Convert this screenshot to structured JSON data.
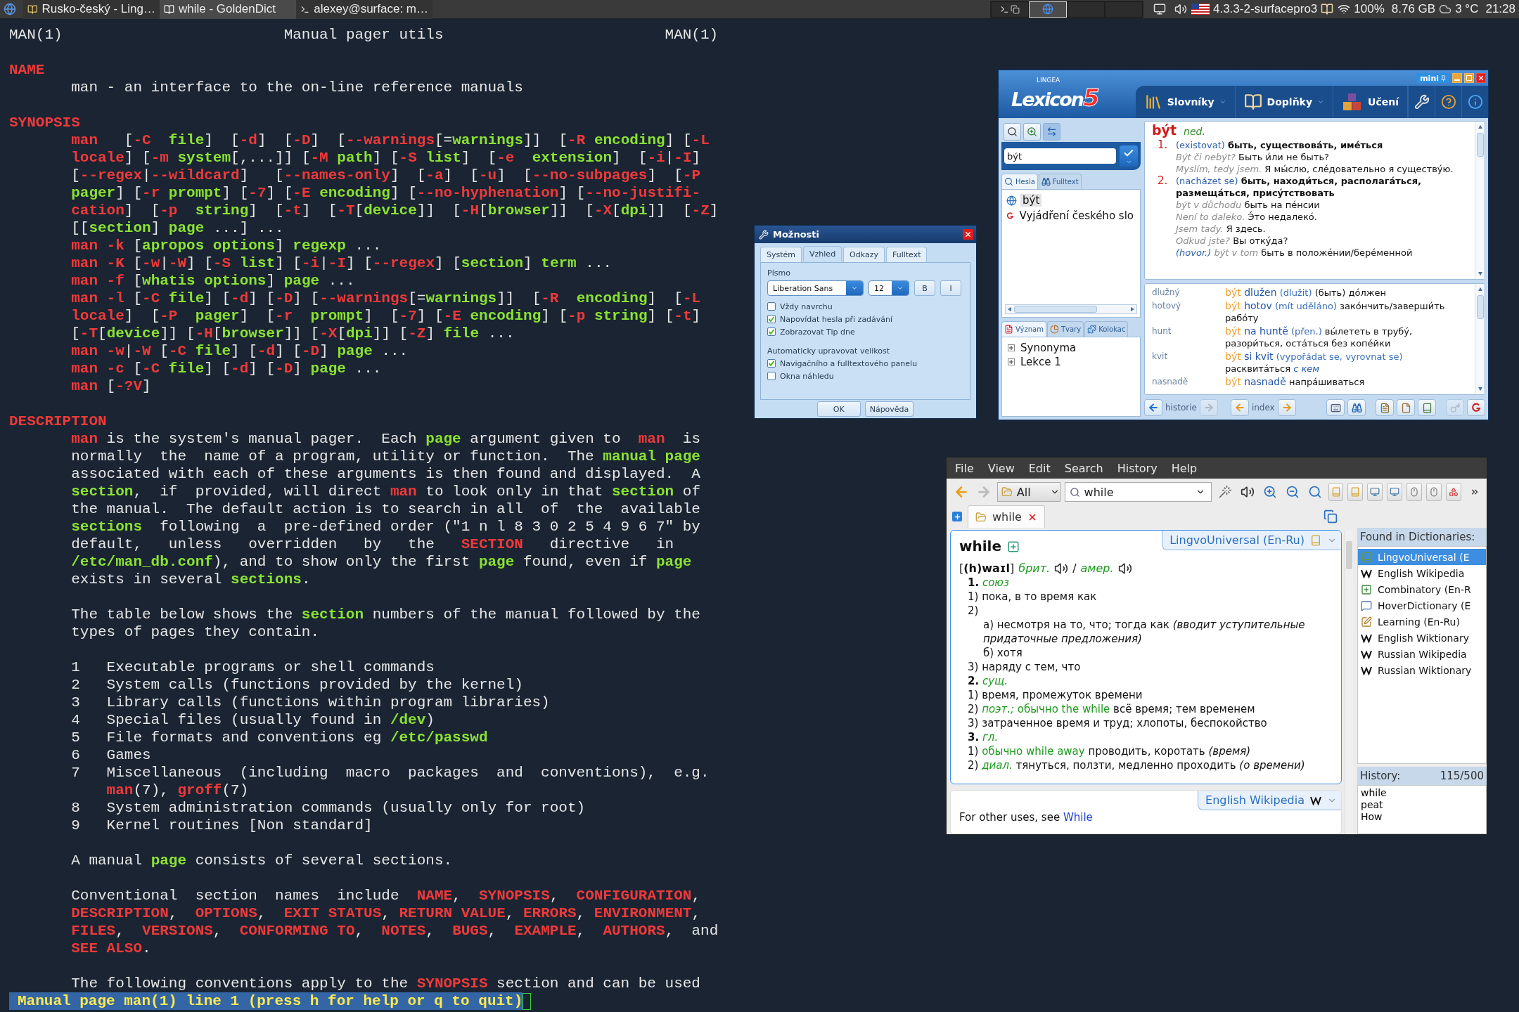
{
  "taskbar": {
    "tasks": [
      {
        "label": "Rusko-český - Ling…",
        "selected": false
      },
      {
        "label": "while - GoldenDict",
        "selected": true
      },
      {
        "label": "alexey@surface: m…",
        "selected": false
      }
    ],
    "kernel": "4.3.3-2-surfacepro3",
    "battery": "100%",
    "memory": "8.76 GB",
    "temperature": "3 °C",
    "clock": "21:28"
  },
  "terminal": {
    "blocks": [
      [
        {
          "kind": "heading",
          "text": [
            "MAN(1)                         Manual pager utils                         MAN(1)"
          ]
        }
      ],
      [
        {
          "kind": "heading",
          "text": [
            {
              "keyword": "NAME"
            }
          ]
        },
        {
          "kind": "body",
          "text": [
            "man - an interface to the on-line reference manuals"
          ]
        }
      ],
      [
        {
          "kind": "heading",
          "text": [
            {
              "keyword": "SYNOPSIS"
            }
          ]
        },
        {
          "kind": "body",
          "text": [
            {
              "keyword": "man"
            },
            "   [",
            {
              "keyword": "-C  "
            },
            {
              "argument": "file"
            },
            "]  [",
            {
              "keyword": "-d"
            },
            "]  [",
            {
              "keyword": "-D"
            },
            "]  [",
            {
              "keyword": "--warnings"
            },
            "[=",
            {
              "argument": "warnings"
            },
            "]]  [",
            {
              "keyword": "-R "
            },
            {
              "argument": "encoding"
            },
            "] [",
            {
              "keyword": "-L"
            }
          ]
        },
        {
          "kind": "body",
          "text": [
            {
              "keyword": "locale"
            },
            "] [",
            {
              "keyword": "-m "
            },
            {
              "argument": "system"
            },
            "[,...]] [",
            {
              "keyword": "-M "
            },
            {
              "argument": "path"
            },
            "] [",
            {
              "keyword": "-S "
            },
            {
              "argument": "list"
            },
            "]  [",
            {
              "keyword": "-e  "
            },
            {
              "argument": "extension"
            },
            "]  [",
            {
              "keyword": "-i"
            },
            "|",
            {
              "keyword": "-I"
            },
            "]"
          ]
        },
        {
          "kind": "body",
          "text": [
            "[",
            {
              "keyword": "--regex"
            },
            "|",
            {
              "keyword": "--wildcard"
            },
            "]   [",
            {
              "keyword": "--names-only"
            },
            "]  [",
            {
              "keyword": "-a"
            },
            "]  [",
            {
              "keyword": "-u"
            },
            "]  [",
            {
              "keyword": "--no-subpages"
            },
            "]  [",
            {
              "keyword": "-P"
            }
          ]
        },
        {
          "kind": "body",
          "text": [
            {
              "argument": "pager"
            },
            "] [",
            {
              "keyword": "-r "
            },
            {
              "argument": "prompt"
            },
            "] [",
            {
              "keyword": "-7"
            },
            "] [",
            {
              "keyword": "-E "
            },
            {
              "argument": "encoding"
            },
            "] [",
            {
              "keyword": "--no-hyphenation"
            },
            "] [",
            {
              "keyword": "--no-justifi-"
            }
          ]
        },
        {
          "kind": "body",
          "text": [
            {
              "keyword": "cation"
            },
            "]  [",
            {
              "keyword": "-p  "
            },
            {
              "argument": "string"
            },
            "]  [",
            {
              "keyword": "-t"
            },
            "]  [",
            {
              "keyword": "-T"
            },
            "[",
            {
              "argument": "device"
            },
            "]]  [",
            {
              "keyword": "-H"
            },
            "[",
            {
              "argument": "browser"
            },
            "]]  [",
            {
              "keyword": "-X"
            },
            "[",
            {
              "argument": "dpi"
            },
            "]]  [",
            {
              "keyword": "-Z"
            },
            "]"
          ]
        },
        {
          "kind": "body",
          "text": [
            "[[",
            {
              "argument": "section"
            },
            "] ",
            {
              "argument": "page"
            },
            " ...] ..."
          ]
        },
        {
          "kind": "body",
          "text": [
            {
              "keyword": "man -k"
            },
            " [",
            {
              "argument": "apropos options"
            },
            "] ",
            {
              "argument": "regexp"
            },
            " ..."
          ]
        },
        {
          "kind": "body",
          "text": [
            {
              "keyword": "man -K"
            },
            " [",
            {
              "keyword": "-w"
            },
            "|",
            {
              "keyword": "-W"
            },
            "] [",
            {
              "keyword": "-S "
            },
            {
              "argument": "list"
            },
            "] [",
            {
              "keyword": "-i"
            },
            "|",
            {
              "keyword": "-I"
            },
            "] [",
            {
              "keyword": "--regex"
            },
            "] [",
            {
              "argument": "section"
            },
            "] ",
            {
              "argument": "term"
            },
            " ..."
          ]
        },
        {
          "kind": "body",
          "text": [
            {
              "keyword": "man -f"
            },
            " [",
            {
              "argument": "whatis options"
            },
            "] ",
            {
              "argument": "page"
            },
            " ..."
          ]
        },
        {
          "kind": "body",
          "text": [
            {
              "keyword": "man -l"
            },
            " [",
            {
              "keyword": "-C "
            },
            {
              "argument": "file"
            },
            "] [",
            {
              "keyword": "-d"
            },
            "] [",
            {
              "keyword": "-D"
            },
            "] [",
            {
              "keyword": "--warnings"
            },
            "[=",
            {
              "argument": "warnings"
            },
            "]]  [",
            {
              "keyword": "-R  "
            },
            {
              "argument": "encoding"
            },
            "]  [",
            {
              "keyword": "-L"
            }
          ]
        },
        {
          "kind": "body",
          "text": [
            {
              "keyword": "locale"
            },
            "]  [",
            {
              "keyword": "-P  "
            },
            {
              "argument": "pager"
            },
            "]  [",
            {
              "keyword": "-r  "
            },
            {
              "argument": "prompt"
            },
            "]  [",
            {
              "keyword": "-7"
            },
            "] [",
            {
              "keyword": "-E "
            },
            {
              "argument": "encoding"
            },
            "] [",
            {
              "keyword": "-p "
            },
            {
              "argument": "string"
            },
            "] [",
            {
              "keyword": "-t"
            },
            "]"
          ]
        },
        {
          "kind": "body",
          "text": [
            "[",
            {
              "keyword": "-T"
            },
            "[",
            {
              "argument": "device"
            },
            "]] [",
            {
              "keyword": "-H"
            },
            "[",
            {
              "argument": "browser"
            },
            "]] [",
            {
              "keyword": "-X"
            },
            "[",
            {
              "argument": "dpi"
            },
            "]] [",
            {
              "keyword": "-Z"
            },
            "] ",
            {
              "argument": "file"
            },
            " ..."
          ]
        },
        {
          "kind": "body",
          "text": [
            {
              "keyword": "man -w"
            },
            "|",
            {
              "keyword": "-W"
            },
            " [",
            {
              "keyword": "-C "
            },
            {
              "argument": "file"
            },
            "] [",
            {
              "keyword": "-d"
            },
            "] [",
            {
              "keyword": "-D"
            },
            "] ",
            {
              "argument": "page"
            },
            " ..."
          ]
        },
        {
          "kind": "body",
          "text": [
            {
              "keyword": "man -c"
            },
            " [",
            {
              "keyword": "-C "
            },
            {
              "argument": "file"
            },
            "] [",
            {
              "keyword": "-d"
            },
            "] [",
            {
              "keyword": "-D"
            },
            "] ",
            {
              "argument": "page"
            },
            " ..."
          ]
        },
        {
          "kind": "body",
          "text": [
            {
              "keyword": "man"
            },
            " [",
            {
              "keyword": "-?V"
            },
            "]"
          ]
        }
      ],
      [
        {
          "kind": "heading",
          "text": [
            {
              "keyword": "DESCRIPTION"
            }
          ]
        },
        {
          "kind": "body",
          "text": [
            {
              "keyword": "man"
            },
            " is the system's manual pager.  Each ",
            {
              "argument": "page"
            },
            " argument given to  ",
            {
              "keyword": "man"
            },
            "  is"
          ]
        },
        {
          "kind": "body",
          "text": [
            "normally  the  name of a program, utility or function.  The ",
            {
              "argument": "manual page"
            }
          ]
        },
        {
          "kind": "body",
          "text": [
            "associated with each of these arguments is then found and displayed.  A"
          ]
        },
        {
          "kind": "body",
          "text": [
            {
              "argument": "section"
            },
            ",  if  provided, will direct ",
            {
              "keyword": "man"
            },
            " to look only in that ",
            {
              "argument": "section"
            },
            " of"
          ]
        },
        {
          "kind": "body",
          "text": [
            "the manual.  The default action is to search in all  of  the  available"
          ]
        },
        {
          "kind": "body",
          "text": [
            {
              "argument": "sections"
            },
            "  following  a  pre-defined order (\"1 n l 8 3 0 2 5 4 9 6 7\" by"
          ]
        },
        {
          "kind": "body",
          "text": [
            "default,   unless   overridden   by   the   ",
            {
              "keyword": "SECTION"
            },
            "   directive   in"
          ]
        },
        {
          "kind": "body",
          "text": [
            {
              "argument": "/etc/man_db.conf"
            },
            "), and to show only the first ",
            {
              "argument": "page"
            },
            " found, even if ",
            {
              "argument": "page"
            }
          ]
        },
        {
          "kind": "body",
          "text": [
            "exists in several ",
            {
              "argument": "sections"
            },
            "."
          ]
        }
      ],
      [
        {
          "kind": "body",
          "text": [
            "The table below shows the ",
            {
              "argument": "section"
            },
            " numbers of the manual followed by the"
          ]
        },
        {
          "kind": "body",
          "text": [
            "types of pages they contain."
          ]
        }
      ],
      [
        {
          "kind": "body",
          "text": [
            "1   Executable programs or shell commands"
          ]
        },
        {
          "kind": "body",
          "text": [
            "2   System calls (functions provided by the kernel)"
          ]
        },
        {
          "kind": "body",
          "text": [
            "3   Library calls (functions within program libraries)"
          ]
        },
        {
          "kind": "body",
          "text": [
            "4   Special files (usually found in ",
            {
              "argument": "/dev"
            },
            ")"
          ]
        },
        {
          "kind": "body",
          "text": [
            "5   File formats and conventions eg ",
            {
              "argument": "/etc/passwd"
            }
          ]
        },
        {
          "kind": "body",
          "text": [
            "6   Games"
          ]
        },
        {
          "kind": "body",
          "text": [
            "7   Miscellaneous  (including  macro  packages  and  conventions),  e.g."
          ]
        },
        {
          "kind": "continuation",
          "text": [
            {
              "keyword": "man"
            },
            "(7), ",
            {
              "keyword": "groff"
            },
            "(7)"
          ]
        },
        {
          "kind": "body",
          "text": [
            "8   System administration commands (usually only for root)"
          ]
        },
        {
          "kind": "body",
          "text": [
            "9   Kernel routines [Non standard]"
          ]
        }
      ],
      [
        {
          "kind": "body",
          "text": [
            "A manual ",
            {
              "argument": "page"
            },
            " consists of several sections."
          ]
        }
      ],
      [
        {
          "kind": "body",
          "text": [
            "Conventional  section  names  include  ",
            {
              "keyword": "NAME"
            },
            ",  ",
            {
              "keyword": "SYNOPSIS"
            },
            ",  ",
            {
              "keyword": "CONFIGURATION"
            },
            ","
          ]
        },
        {
          "kind": "body",
          "text": [
            {
              "keyword": "DESCRIPTION"
            },
            ",  ",
            {
              "keyword": "OPTIONS"
            },
            ",  ",
            {
              "keyword": "EXIT STATUS"
            },
            ", ",
            {
              "keyword": "RETURN VALUE"
            },
            ", ",
            {
              "keyword": "ERRORS"
            },
            ", ",
            {
              "keyword": "ENVIRONMENT"
            },
            ","
          ]
        },
        {
          "kind": "body",
          "text": [
            {
              "keyword": "FILES"
            },
            ",  ",
            {
              "keyword": "VERSIONS"
            },
            ",  ",
            {
              "keyword": "CONFORMING TO"
            },
            ",  ",
            {
              "keyword": "NOTES"
            },
            ",  ",
            {
              "keyword": "BUGS"
            },
            ",  ",
            {
              "keyword": "EXAMPLE"
            },
            ",  ",
            {
              "keyword": "AUTHORS"
            },
            ",  and"
          ]
        },
        {
          "kind": "body",
          "text": [
            {
              "keyword": "SEE ALSO"
            },
            "."
          ]
        }
      ],
      [
        {
          "kind": "body",
          "text": [
            "The following conventions apply to the ",
            {
              "keyword": "SYNOPSIS"
            },
            " section and can be used"
          ]
        }
      ]
    ],
    "status_line": "Manual page man(1) line 1 (press h for help or q to quit)"
  },
  "lexicon": {
    "logo_brand": "LINGEA",
    "logo_name": "Lexicon",
    "logo_version": "5",
    "mini_button": "mini",
    "menu": [
      {
        "label": "Slovníky",
        "dropdown": true
      },
      {
        "label": "Doplňky",
        "dropdown": true
      },
      {
        "label": "Učení",
        "dropdown": false
      }
    ],
    "search_value": "být",
    "list_tabs": [
      {
        "label": "Hesla",
        "selected": true
      },
      {
        "label": "Fulltext",
        "selected": false
      }
    ],
    "results": [
      {
        "label": "být",
        "selected": true
      },
      {
        "label": "Vyjádření českého slo",
        "selected": false
      }
    ],
    "panel_tabs": [
      {
        "label": "Význam",
        "selected": true
      },
      {
        "label": "Tvary",
        "selected": false
      },
      {
        "label": "Kolokac",
        "selected": false
      }
    ],
    "tree": [
      {
        "label": "Synonyma",
        "expanded": false
      },
      {
        "label": "Lekce 1",
        "expanded": false
      }
    ],
    "entry": {
      "headword": "být",
      "pos": "ned.",
      "senses": [
        {
          "number": "1.",
          "domain": "(existovat)",
          "meaning": "быть, существова́ть, име́ться",
          "examples": [
            {
              "cz": "Být či nebýt?",
              "ru": "Быть и́ли не быть?"
            },
            {
              "cz": "Myslím, tedy jsem.",
              "ru": "Я мы́слю, сле́довательно я существу́ю."
            }
          ]
        },
        {
          "number": "2.",
          "domain": "(nacházet se)",
          "meaning": "быть, находи́ться, располага́ться, размеща́ться, прису́тствовать",
          "examples": [
            {
              "cz": "být v důchodu",
              "ru": "быть на пе́нсии"
            },
            {
              "cz": "Není to daleko.",
              "ru": "Э́то недалеко́."
            },
            {
              "cz": "Jsem tady.",
              "ru": "Я здесь."
            },
            {
              "cz": "Odkud jste?",
              "ru": "Вы отку́да?"
            },
            {
              "register": "(hovor.)",
              "cz": "být v tom",
              "ru": "быть в положе́нии/бере́менной"
            }
          ]
        }
      ]
    },
    "phrases": [
      {
        "word": "dlužný",
        "head": "být",
        "phrase": "dlužen",
        "gloss": "(dlužit)",
        "translation": "(быть) до́лжен"
      },
      {
        "word": "hotový",
        "head": "být",
        "phrase": "hotov",
        "gloss": "(mít uděláno)",
        "translation": "зако́нчить/заверши́ть рабо́ту"
      },
      {
        "word": "hunt",
        "head": "být",
        "phrase": "na huntě",
        "gloss": "(přen.)",
        "translation": "вы́лететь в трубу́, разори́ться, оста́ться без копе́йки"
      },
      {
        "word": "kvit",
        "head": "být",
        "phrase": "si kvit",
        "gloss": "(vypořádat se, vyrovnat se)",
        "translation": "расквита́ться",
        "note": "с кем"
      },
      {
        "word": "nasnadě",
        "head": "být",
        "phrase": "nasnadě",
        "translation": "напра́шиваться"
      }
    ],
    "nav_history": "historie",
    "nav_index": "index"
  },
  "dialog": {
    "title": "Možnosti",
    "tabs": [
      {
        "label": "Systém",
        "selected": false
      },
      {
        "label": "Vzhled",
        "selected": true
      },
      {
        "label": "Odkazy",
        "selected": false
      },
      {
        "label": "Fulltext",
        "selected": false
      }
    ],
    "font_group": "Písmo",
    "font_family": "Liberation Sans",
    "font_size": "12",
    "bold_button": "B",
    "italic_button": "I",
    "options": [
      {
        "label": "Vždy navrchu",
        "checked": false
      },
      {
        "label": "Napovídat hesla při zadávání",
        "checked": true
      },
      {
        "label": "Zobrazovat Tip dne",
        "checked": true
      }
    ],
    "autosize_label": "Automaticky upravovat velikost",
    "autosize_options": [
      {
        "label": "Navigačního a fulltextového panelu",
        "checked": true
      },
      {
        "label": "Okna náhledu",
        "checked": false
      }
    ],
    "buttons": [
      "OK",
      "Nápověda"
    ]
  },
  "goldendict": {
    "menu": [
      "File",
      "View",
      "Edit",
      "Search",
      "History",
      "Help"
    ],
    "group": "All",
    "query": "while",
    "tab": "while",
    "article": {
      "headword": "while",
      "dictionary": "LingvoUniversal (En-Ru)",
      "transcription": "[**(h)waɪl**]",
      "accent_1": "брит.",
      "separator": "/",
      "accent_2": "амер.",
      "lines": [
        {
          "kind": "heading",
          "number": "1.",
          "label": "союз"
        },
        {
          "kind": "sense",
          "parts": [
            "1) пока, в то время как"
          ]
        },
        {
          "kind": "sense",
          "parts": [
            "2)"
          ]
        },
        {
          "kind": "subsense",
          "parts": [
            "а) несмотря на то, что; тогда как *(вводит уступительные придаточные предложения)*"
          ]
        },
        {
          "kind": "subsense",
          "parts": [
            "б) хотя"
          ]
        },
        {
          "kind": "sense",
          "parts": [
            "3) наряду с тем, что"
          ]
        },
        {
          "kind": "heading",
          "number": "2.",
          "label": "сущ."
        },
        {
          "kind": "sense",
          "parts": [
            "1) время, промежуток времени"
          ]
        },
        {
          "kind": "sense",
          "parts": [
            "2) ",
            {
              "label": "поэт.;"
            },
            {
              "example": " обычно the while"
            },
            " всё время; тем временем"
          ]
        },
        {
          "kind": "sense",
          "parts": [
            "3) затраченное время и труд; хлопоты, беспокойство"
          ]
        },
        {
          "kind": "heading",
          "number": "3.",
          "label": "гл."
        },
        {
          "kind": "sense",
          "parts": [
            "1) ",
            {
              "example": "обычно while away"
            },
            " проводить, коротать *(время)*"
          ]
        },
        {
          "kind": "sense",
          "parts": [
            "2) ",
            {
              "label": "диал."
            },
            " тянуться, ползти, медленно проходить *(о времени)*"
          ]
        }
      ]
    },
    "article2": {
      "dictionary": "English Wikipedia",
      "text": "For other uses, see ",
      "link": "While"
    },
    "found_title": "Found in Dictionaries:",
    "dictionaries": [
      {
        "label": "LingvoUniversal (E",
        "selected": true,
        "kind": "book"
      },
      {
        "label": "English Wikipedia",
        "selected": false,
        "kind": "wiki"
      },
      {
        "label": "Combinatory (En-R",
        "selected": false,
        "kind": "plus"
      },
      {
        "label": "HoverDictionary (E",
        "selected": false,
        "kind": "chat"
      },
      {
        "label": "Learning (En-Ru)",
        "selected": false,
        "kind": "note"
      },
      {
        "label": "English Wiktionary",
        "selected": false,
        "kind": "wiki"
      },
      {
        "label": "Russian Wikipedia",
        "selected": false,
        "kind": "wiki"
      },
      {
        "label": "Russian Wiktionary",
        "selected": false,
        "kind": "wiki"
      }
    ],
    "history_title": "History:",
    "history_count": "115/500",
    "history": [
      "while",
      "peat",
      "How"
    ]
  }
}
